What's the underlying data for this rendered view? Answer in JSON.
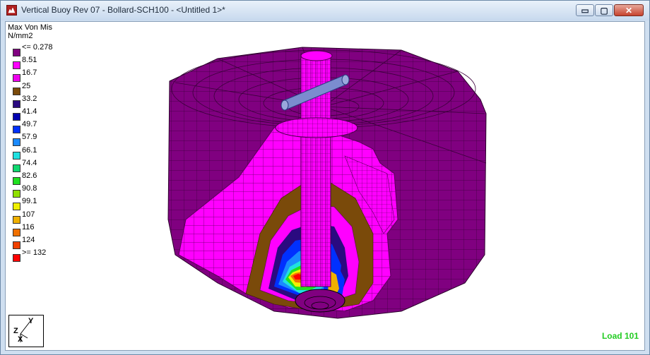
{
  "window": {
    "title": "Vertical Buoy Rev 07 - Bollard-SCH100 - <Untitled 1>*",
    "buttons": {
      "minimize": "▭",
      "maximize": "▢",
      "close": "✕"
    }
  },
  "legend": {
    "title": "Max Von Mis",
    "units": "N/mm2",
    "entries": [
      {
        "label": "<= 0.278",
        "color": "#800080"
      },
      {
        "label": "8.51",
        "color": "#ff00ff"
      },
      {
        "label": "16.7",
        "color": "#ee00ee"
      },
      {
        "label": "25",
        "color": "#7a4a0a"
      },
      {
        "label": "33.2",
        "color": "#2a0a80"
      },
      {
        "label": "41.4",
        "color": "#0000b0"
      },
      {
        "label": "49.7",
        "color": "#0030ff"
      },
      {
        "label": "57.9",
        "color": "#1a8aff"
      },
      {
        "label": "66.1",
        "color": "#20e0e0"
      },
      {
        "label": "74.4",
        "color": "#10d870"
      },
      {
        "label": "82.6",
        "color": "#20e020"
      },
      {
        "label": "90.8",
        "color": "#90e000"
      },
      {
        "label": "99.1",
        "color": "#f0f000"
      },
      {
        "label": "107",
        "color": "#f0b000"
      },
      {
        "label": "116",
        "color": "#f07000"
      },
      {
        "label": "124",
        "color": "#f04000"
      },
      {
        "label": ">= 132",
        "color": "#ff0000"
      }
    ]
  },
  "triad": {
    "y": "Y",
    "z": "Z",
    "x": "X"
  },
  "status": {
    "load_case": "Load 101"
  },
  "colors": {
    "mesh_outer": "#800080",
    "mesh_inner": "#ff00ff",
    "mesh_mid": "#7a4a0a",
    "accent_pipe": "#7b8ccf"
  }
}
